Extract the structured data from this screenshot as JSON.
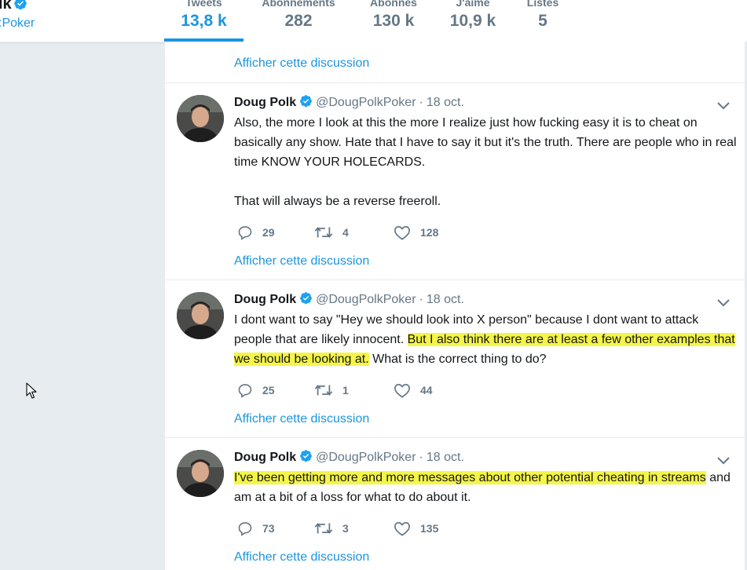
{
  "profile": {
    "name_fragment": "lk",
    "handle_fragment": ":Poker"
  },
  "nav": {
    "stats": [
      {
        "label": "Tweets",
        "value": "13,8 k",
        "active": true
      },
      {
        "label": "Abonnements",
        "value": "282"
      },
      {
        "label": "Abonnés",
        "value": "130 k"
      },
      {
        "label": "J'aime",
        "value": "10,9 k"
      },
      {
        "label": "Listes",
        "value": "5"
      }
    ]
  },
  "colors": {
    "accent": "#1b95e0",
    "highlight": "#f5f549",
    "muted": "#657786",
    "page_bg": "#e6ecf0"
  },
  "thread_link_label": "Afficher cette discussion",
  "tweets": [
    {
      "author": "Doug Polk",
      "handle": "@DougPolkPoker",
      "separator": "·",
      "time": "18 oct.",
      "paragraph1": "Also, the more I look at this the more I realize just how fucking easy it is to cheat on basically any show. Hate that I have to say it but it's the truth. There are people who in real time KNOW YOUR HOLECARDS.",
      "paragraph2": "That will always be a reverse freeroll.",
      "replies": "29",
      "retweets": "4",
      "likes": "128"
    },
    {
      "author": "Doug Polk",
      "handle": "@DougPolkPoker",
      "separator": "·",
      "time": "18 oct.",
      "text_before": "I dont want to say \"Hey we should look into X person\" because I dont want to attack people that are likely innocent. ",
      "text_highlight": "But I also think there are at least a few other examples that we should be looking at.",
      "text_after": " What is the correct thing to do?",
      "replies": "25",
      "retweets": "1",
      "likes": "44"
    },
    {
      "author": "Doug Polk",
      "handle": "@DougPolkPoker",
      "separator": "·",
      "time": "18 oct.",
      "text_highlight": "I've been getting more and more messages about other potential cheating in streams",
      "text_after": " and am at a bit of a loss for what to do about it.",
      "replies": "73",
      "retweets": "3",
      "likes": "135"
    }
  ],
  "icons": [
    "verified-badge-icon",
    "reply-icon",
    "retweet-icon",
    "like-icon",
    "chevron-down-icon",
    "mouse-cursor-icon"
  ]
}
